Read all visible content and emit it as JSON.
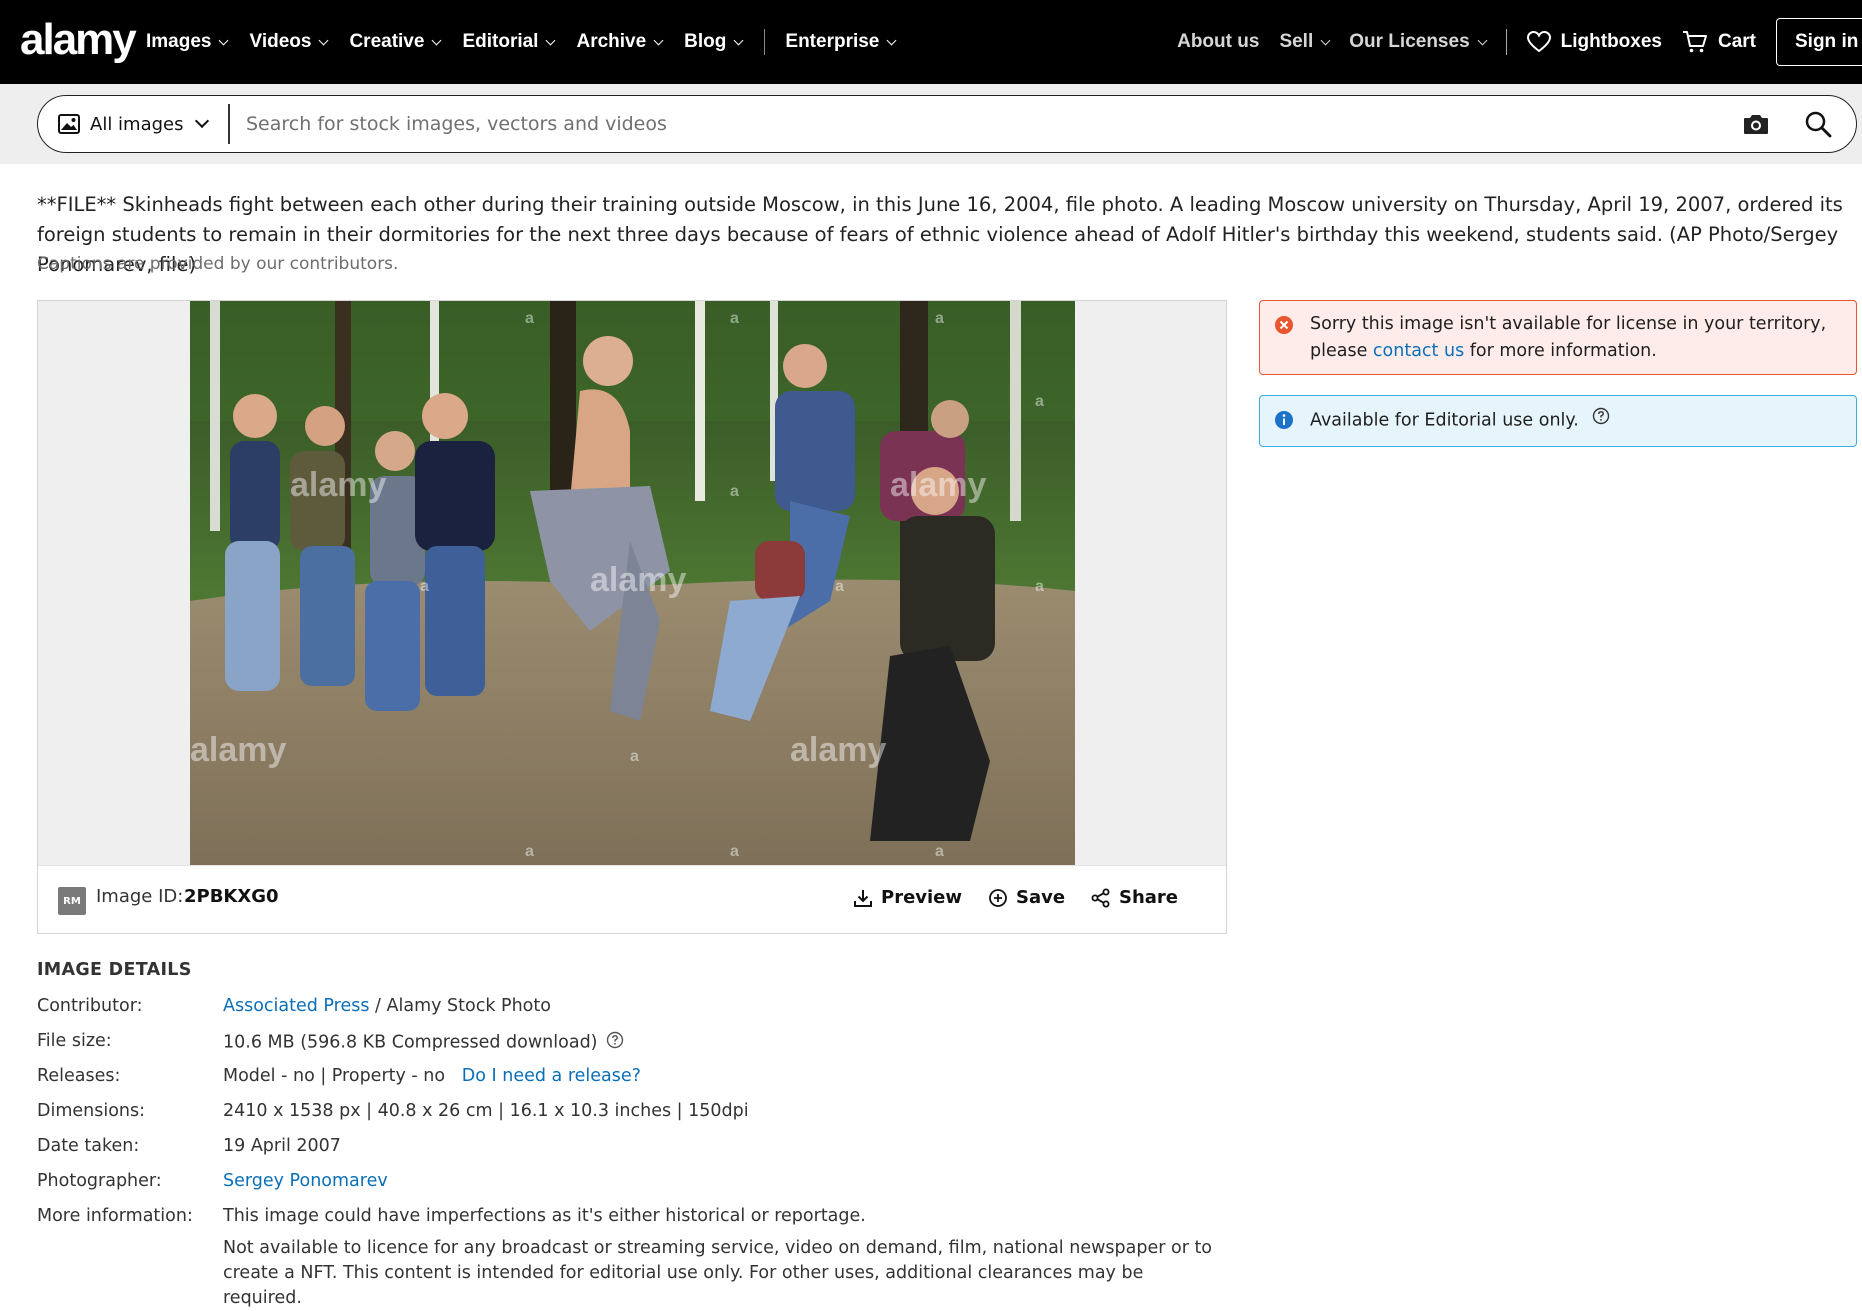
{
  "brand": {
    "logo": "alamy"
  },
  "nav": {
    "left": [
      {
        "label": "Images"
      },
      {
        "label": "Videos"
      },
      {
        "label": "Creative"
      },
      {
        "label": "Editorial"
      },
      {
        "label": "Archive"
      },
      {
        "label": "Blog"
      }
    ],
    "enterprise": "Enterprise",
    "about": "About us",
    "sell": "Sell",
    "licenses": "Our Licenses",
    "lightboxes": "Lightboxes",
    "cart": "Cart",
    "signin": "Sign in"
  },
  "search": {
    "scope": "All images",
    "placeholder": "Search for stock images, vectors and videos",
    "icons": [
      "image-icon",
      "camera-icon",
      "search-icon"
    ]
  },
  "caption": {
    "text": "**FILE** Skinheads fight between each other during their training outside Moscow, in this June 16, 2004, file photo. A leading Moscow university on Thursday, April 19, 2007, ordered its foreign students to remain in their dormitories for the next three days because of fears of ethnic violence ahead of Adolf Hitler's birthday this weekend, students said. (AP Photo/Sergey Ponomarev, file)",
    "note": "Captions are provided by our contributors."
  },
  "image": {
    "rights_badge": "RM",
    "id_label": "Image ID:",
    "id": "2PBKXG0",
    "watermark": "alamy",
    "actions": {
      "preview": "Preview",
      "save": "Save",
      "share": "Share"
    }
  },
  "alerts": {
    "territory": {
      "before": "Sorry this image isn't available for license in your territory, please ",
      "link": "contact us",
      "after": " for more information."
    },
    "editorial": "Available for Editorial use only."
  },
  "details": {
    "title": "IMAGE DETAILS",
    "contributor_label": "Contributor:",
    "contributor_link": "Associated Press",
    "contributor_rest": " / Alamy Stock Photo",
    "filesize_label": "File size:",
    "filesize": "10.6 MB (596.8 KB Compressed download)",
    "releases_label": "Releases:",
    "releases": "Model - no | Property - no",
    "release_link": "Do I need a release?",
    "dimensions_label": "Dimensions:",
    "dimensions": "2410 x 1538 px | 40.8 x 26 cm | 16.1 x 10.3 inches | 150dpi",
    "date_label": "Date taken:",
    "date": "19 April 2007",
    "photographer_label": "Photographer:",
    "photographer": "Sergey Ponomarev",
    "more_label": "More information:",
    "more_1": "This image could have imperfections as it's either historical or reportage.",
    "more_2": "Not available to licence for any broadcast or streaming service, video on demand, film, national newspaper or to create a NFT. This content is intended for editorial use only. For other uses, additional clearances may be required."
  },
  "colors": {
    "nav_bg": "#000000",
    "link": "#0a6fb8",
    "error_border": "#e8552f",
    "info_border": "#3ab0e2"
  }
}
